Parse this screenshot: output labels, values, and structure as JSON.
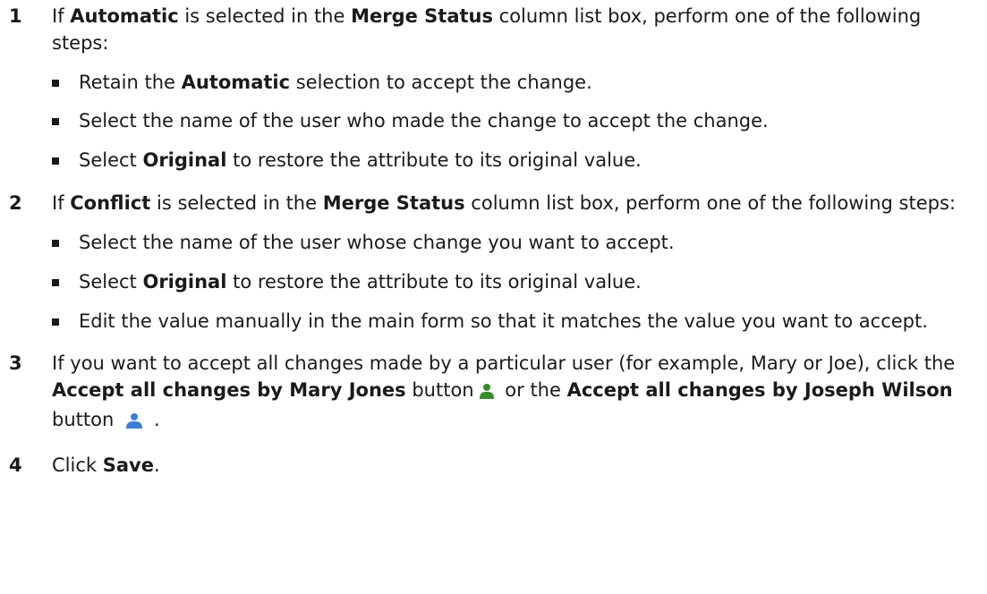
{
  "steps": [
    {
      "number": "1",
      "parts": [
        "If ",
        "Automatic",
        " is selected in the ",
        "Merge Status",
        " column list box, perform one of the following steps:"
      ],
      "subs": [
        [
          "Retain the ",
          "Automatic",
          " selection to accept the change."
        ],
        [
          "Select the name of the user who made the change to accept the change."
        ],
        [
          "Select ",
          "Original",
          " to restore the attribute to its original value."
        ]
      ]
    },
    {
      "number": "2",
      "parts": [
        "If ",
        "Conflict",
        " is selected in the ",
        "Merge Status",
        " column list box, perform one of the following steps:"
      ],
      "subs": [
        [
          "Select the name of the user whose change you want to accept."
        ],
        [
          "Select ",
          "Original",
          " to restore the attribute to its original value."
        ],
        [
          "Edit the value manually in the main form so that it matches the value you want to accept."
        ]
      ]
    },
    {
      "number": "3",
      "parts": [
        "If you want to accept all changes made by a particular user (for example, Mary or Joe), click the ",
        "Accept all changes by Mary Jones",
        " button",
        " or the ",
        "Accept all changes by Joseph Wilson",
        " button",
        " ."
      ]
    },
    {
      "number": "4",
      "parts": [
        "Click ",
        "Save",
        "."
      ]
    }
  ],
  "icons": {
    "mary": {
      "name": "user-green-icon",
      "color": "#3a8a2e"
    },
    "joseph": {
      "name": "user-blue-icon",
      "color": "#3b7fd1"
    }
  }
}
